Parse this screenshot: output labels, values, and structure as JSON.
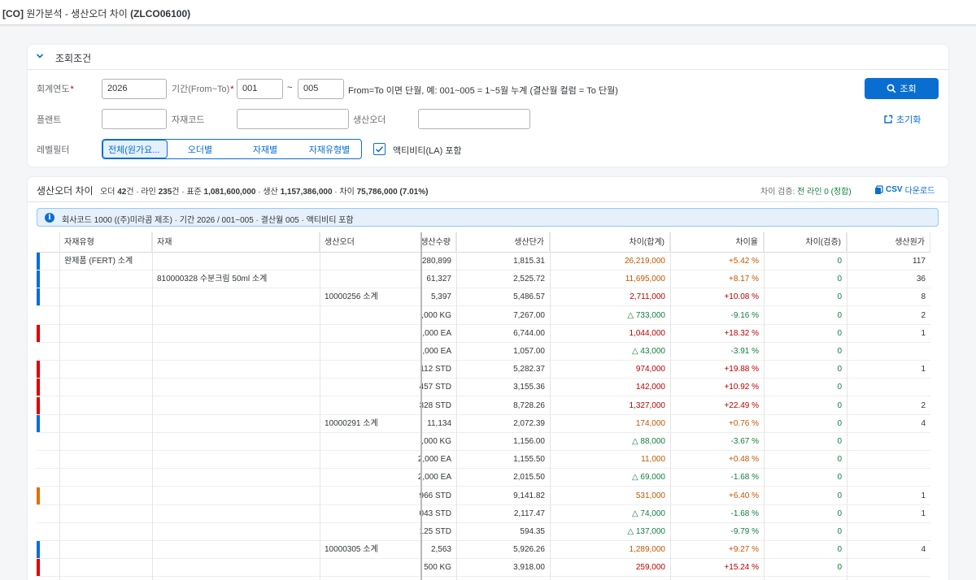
{
  "shell": {
    "title_prefix": "[CO]",
    "title_main": "원가분석 - 생산오더 차이",
    "title_code": "(ZLCO06100)"
  },
  "filter": {
    "section_title": "조회조건",
    "labels": {
      "fiscal_year": "회계연도",
      "period": "기간(From~To)",
      "plant": "플랜트",
      "material_code": "자재코드",
      "prod_order": "생산오더",
      "level_filter": "레벨필터"
    },
    "required_mark": "*",
    "values": {
      "fiscal_year": "2026",
      "period_from": "001",
      "period_to": "005",
      "plant": "",
      "material_code": "",
      "prod_order": ""
    },
    "tilde": "~",
    "period_hint": "From=To 이면 단월, 예: 001~005 = 1~5월 누계 (결산월 컬럼 = To 단월)",
    "search_button": "조회",
    "reset_button": "초기화",
    "level_options": [
      "전체(원가요...",
      "오더별",
      "자재별",
      "자재유형별"
    ],
    "level_selected": 0,
    "activity_checkbox_label": "액티비티(LA) 포함",
    "activity_checked": true
  },
  "table": {
    "title": "생산오더 차이",
    "summary": {
      "t1": "오더 ",
      "orders": "42",
      "t2": "건 · 라인 ",
      "lines": "235",
      "t3": "건 · 표준 ",
      "standard": "1,081,600,000",
      "t4": " · 생산 ",
      "actual": "1,157,386,000",
      "t5": " · 차이 ",
      "variance": "75,786,000 (7.01%)"
    },
    "verify_label": "차이 검증:",
    "verify_value": "전 라인 0 (정합)",
    "csv_label": "CSV",
    "csv_suffix": "다운로드",
    "info_text": "회사코드 1000 ((주)미라콤 제조) · 기간 2026 / 001~005 · 결산월 005 · 액티비티 포함",
    "columns": [
      "자재유형",
      "자재",
      "생산오더",
      "생산수량",
      "생산단가",
      "차이(합계)",
      "차이율",
      "차이(검증)",
      "생산원가"
    ],
    "rows": [
      {
        "marker": "#0a6ed1",
        "type": "완제품 (FERT) 소계",
        "material": "",
        "order": "",
        "qty": "280,899",
        "price": "1,815.31",
        "var": "26,219,000",
        "var_cls": "amb",
        "rate": "+5.42 %",
        "rate_cls": "amb",
        "chk": "0",
        "cost": "117"
      },
      {
        "marker": "#0a6ed1",
        "type": "",
        "material": "810000328 수분크림 50ml 소계",
        "order": "",
        "qty": "61,327",
        "price": "2,525.72",
        "var": "11,695,000",
        "var_cls": "amb",
        "rate": "+8.17 %",
        "rate_cls": "amb",
        "chk": "0",
        "cost": "36"
      },
      {
        "marker": "#0a6ed1",
        "type": "",
        "material": "",
        "order": "10000256 소계",
        "qty": "5,397",
        "price": "5,486.57",
        "var": "2,711,000",
        "var_cls": "pos",
        "rate": "+10.08 %",
        "rate_cls": "pos",
        "chk": "0",
        "cost": "8"
      },
      {
        "marker": "",
        "type": "",
        "material": "",
        "order": "",
        "qty": ",000 KG",
        "price": "7,267.00",
        "var": "△ 733,000",
        "var_cls": "neg",
        "rate": "-9.16 %",
        "rate_cls": "neg",
        "chk": "0",
        "cost": "2"
      },
      {
        "marker": "#e00000",
        "type": "",
        "material": "",
        "order": "",
        "qty": ",000 EA",
        "price": "6,744.00",
        "var": "1,044,000",
        "var_cls": "pos",
        "rate": "+18.32 %",
        "rate_cls": "pos",
        "chk": "0",
        "cost": "1"
      },
      {
        "marker": "",
        "type": "",
        "material": "",
        "order": "",
        "qty": ",000 EA",
        "price": "1,057.00",
        "var": "△ 43,000",
        "var_cls": "neg",
        "rate": "-3.91 %",
        "rate_cls": "neg",
        "chk": "0",
        "cost": ""
      },
      {
        "marker": "#e00000",
        "type": "",
        "material": "",
        "order": "",
        "qty": "112 STD",
        "price": "5,282.37",
        "var": "974,000",
        "var_cls": "pos",
        "rate": "+19.88 %",
        "rate_cls": "pos",
        "chk": "0",
        "cost": "1"
      },
      {
        "marker": "#e00000",
        "type": "",
        "material": "",
        "order": "",
        "qty": "457 STD",
        "price": "3,155.36",
        "var": "142,000",
        "var_cls": "pos",
        "rate": "+10.92 %",
        "rate_cls": "pos",
        "chk": "0",
        "cost": ""
      },
      {
        "marker": "#e00000",
        "type": "",
        "material": "",
        "order": "",
        "qty": "328 STD",
        "price": "8,728.26",
        "var": "1,327,000",
        "var_cls": "pos",
        "rate": "+22.49 %",
        "rate_cls": "pos",
        "chk": "0",
        "cost": "2"
      },
      {
        "marker": "#0a6ed1",
        "type": "",
        "material": "",
        "order": "10000291 소계",
        "qty": "11,134",
        "price": "2,072.39",
        "var": "174,000",
        "var_cls": "amb",
        "rate": "+0.76 %",
        "rate_cls": "amb",
        "chk": "0",
        "cost": "4"
      },
      {
        "marker": "",
        "type": "",
        "material": "",
        "order": "",
        "qty": ",000 KG",
        "price": "1,156.00",
        "var": "△ 88,000",
        "var_cls": "neg",
        "rate": "-3.67 %",
        "rate_cls": "neg",
        "chk": "0",
        "cost": ""
      },
      {
        "marker": "",
        "type": "",
        "material": "",
        "order": "",
        "qty": "2,000 EA",
        "price": "1,155.50",
        "var": "11,000",
        "var_cls": "amb",
        "rate": "+0.48 %",
        "rate_cls": "amb",
        "chk": "0",
        "cost": ""
      },
      {
        "marker": "",
        "type": "",
        "material": "",
        "order": "",
        "qty": "2,000 EA",
        "price": "2,015.50",
        "var": "△ 69,000",
        "var_cls": "neg",
        "rate": "-1.68 %",
        "rate_cls": "neg",
        "chk": "0",
        "cost": ""
      },
      {
        "marker": "#e07000",
        "type": "",
        "material": "",
        "order": "",
        "qty": "966 STD",
        "price": "9,141.82",
        "var": "531,000",
        "var_cls": "amb",
        "rate": "+6.40 %",
        "rate_cls": "amb",
        "chk": "0",
        "cost": "1"
      },
      {
        "marker": "",
        "type": "",
        "material": "",
        "order": "",
        "qty": "043 STD",
        "price": "2,117.47",
        "var": "△ 74,000",
        "var_cls": "neg",
        "rate": "-1.68 %",
        "rate_cls": "neg",
        "chk": "0",
        "cost": "1"
      },
      {
        "marker": "",
        "type": "",
        "material": "",
        "order": "",
        "qty": "125 STD",
        "price": "594.35",
        "var": "△ 137,000",
        "var_cls": "neg",
        "rate": "-9.79 %",
        "rate_cls": "neg",
        "chk": "0",
        "cost": ""
      },
      {
        "marker": "#0a6ed1",
        "type": "",
        "material": "",
        "order": "10000305 소계",
        "qty": "2,563",
        "price": "5,926.26",
        "var": "1,289,000",
        "var_cls": "amb",
        "rate": "+9.27 %",
        "rate_cls": "amb",
        "chk": "0",
        "cost": "4"
      },
      {
        "marker": "#e00000",
        "type": "",
        "material": "",
        "order": "",
        "qty": "500 KG",
        "price": "3,918.00",
        "var": "259,000",
        "var_cls": "pos",
        "rate": "+15.24 %",
        "rate_cls": "pos",
        "chk": "0",
        "cost": ""
      }
    ]
  },
  "colors": {
    "accent": "#0a6ed1",
    "positive_var": "#bb0000",
    "negative_var": "#107e3e",
    "warning_var": "#c35500"
  }
}
